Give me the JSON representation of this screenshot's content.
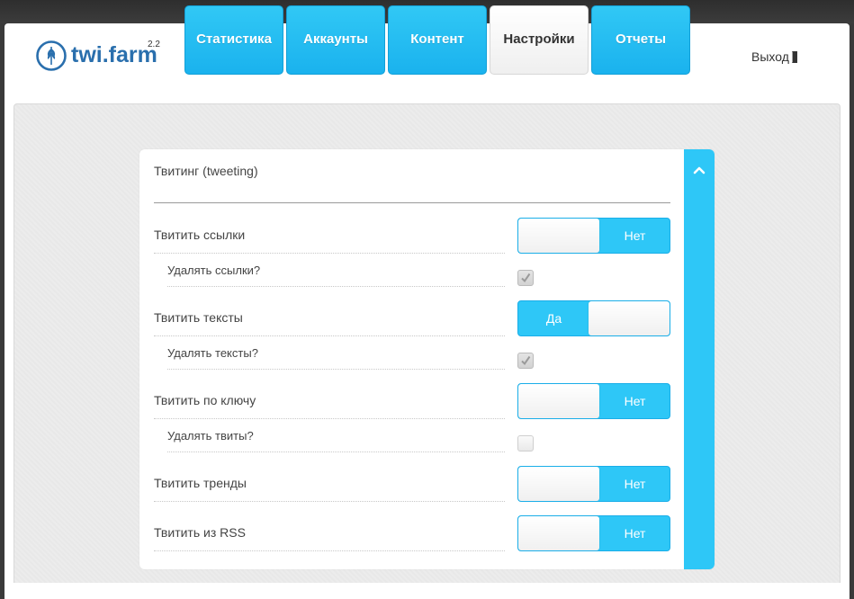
{
  "app": {
    "logo_text_a": "twi",
    "logo_text_dot": ".",
    "logo_text_b": "farm",
    "version": "2.2",
    "brand_color": "#2a6fad",
    "accent_color": "#2ec7f7"
  },
  "nav": {
    "tabs": [
      {
        "label": "Статистика",
        "active": false
      },
      {
        "label": "Аккаунты",
        "active": false
      },
      {
        "label": "Контент",
        "active": false
      },
      {
        "label": "Настройки",
        "active": true
      },
      {
        "label": "Отчеты",
        "active": false
      }
    ],
    "logout_label": "Выход"
  },
  "settings": {
    "section_title": "Твитинг (tweeting)",
    "rows": [
      {
        "label": "Твитить ссылки",
        "type": "toggle",
        "value": "Нет",
        "on": false
      },
      {
        "label": "Удалять ссылки?",
        "type": "checkbox",
        "checked": true
      },
      {
        "label": "Твитить тексты",
        "type": "toggle",
        "value": "Да",
        "on": true
      },
      {
        "label": "Удалять тексты?",
        "type": "checkbox",
        "checked": true
      },
      {
        "label": "Твитить по ключу",
        "type": "toggle",
        "value": "Нет",
        "on": false
      },
      {
        "label": "Удалять твиты?",
        "type": "checkbox",
        "checked": false
      },
      {
        "label": "Твитить тренды",
        "type": "toggle",
        "value": "Нет",
        "on": false
      },
      {
        "label": "Твитить из RSS",
        "type": "toggle",
        "value": "Нет",
        "on": false
      }
    ]
  }
}
